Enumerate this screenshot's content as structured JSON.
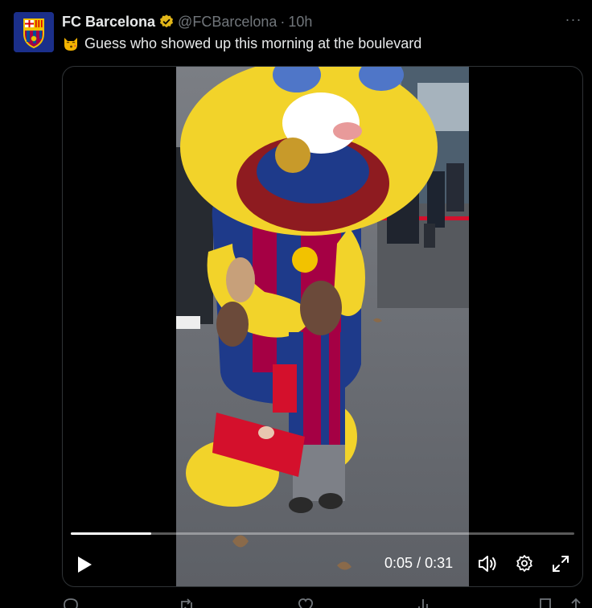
{
  "tweet": {
    "display_name": "FC Barcelona",
    "handle": "@FCBarcelona",
    "separator": "·",
    "time": "10h",
    "more": "···",
    "text": "Guess who showed up this morning at the boulevard"
  },
  "video": {
    "current_time": "0:05",
    "duration": "0:31",
    "time_separator": "/",
    "progress_fraction": 0.16
  },
  "icons": [
    "verified-badge-icon",
    "kissing-cat-emoji",
    "play-icon",
    "volume-icon",
    "settings-gear-icon",
    "fullscreen-icon"
  ],
  "colors": {
    "accent_blue": "#1d9bf0",
    "verified_gold": "#e2b719",
    "background": "#000000",
    "muted_text": "#71767b"
  }
}
